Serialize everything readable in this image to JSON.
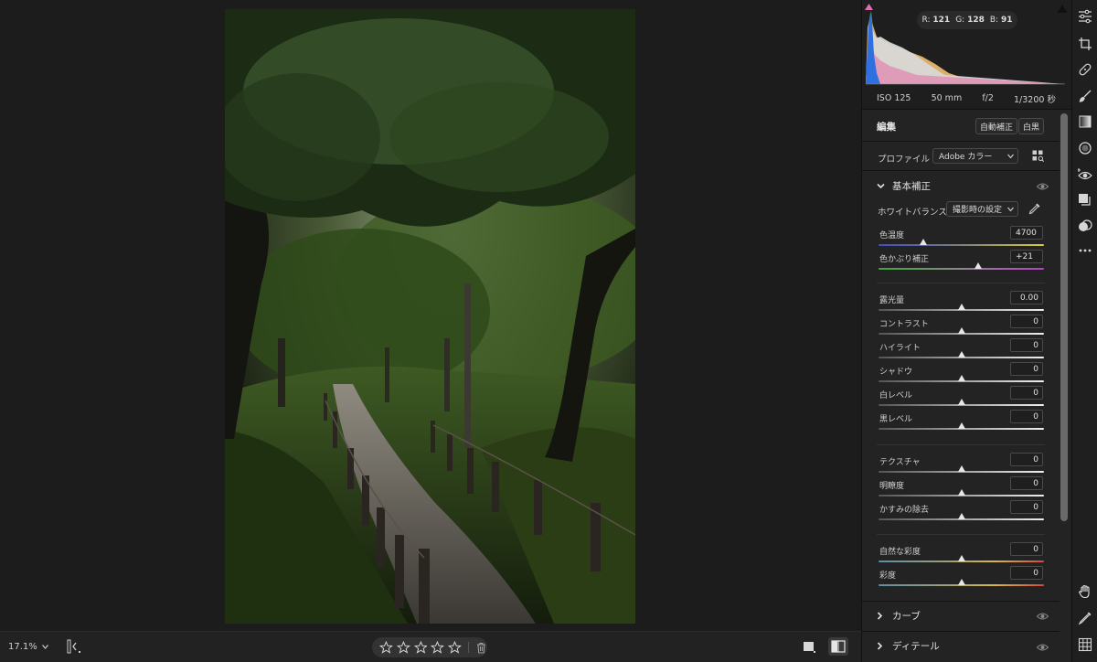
{
  "canvas": {
    "zoom_label": "17.1%"
  },
  "rating": {
    "stars": 0,
    "max": 5
  },
  "histogram": {
    "r_label": "R:",
    "r_value": "121",
    "g_label": "G:",
    "g_value": "128",
    "b_label": "B:",
    "b_value": "91"
  },
  "exif": {
    "iso": "ISO 125",
    "focal": "50 mm",
    "aperture": "f/2",
    "shutter": "1/3200 秒"
  },
  "edit": {
    "title": "編集",
    "auto_label": "自動補正",
    "bw_label": "白黒",
    "profile_label": "プロファイル",
    "profile_value": "Adobe カラー"
  },
  "basic": {
    "title": "基本補正",
    "wb_label": "ホワイトバランス",
    "wb_value": "撮影時の設定",
    "sliders": [
      {
        "label": "色温度",
        "value": "4700",
        "pos": 0.27,
        "track": "temp"
      },
      {
        "label": "色かぶり補正",
        "value": "+21",
        "pos": 0.6,
        "track": "tint"
      },
      {
        "label": "露光量",
        "value": "0.00",
        "pos": 0.5,
        "track": "plain"
      },
      {
        "label": "コントラスト",
        "value": "0",
        "pos": 0.5,
        "track": "plain"
      },
      {
        "label": "ハイライト",
        "value": "0",
        "pos": 0.5,
        "track": "plain"
      },
      {
        "label": "シャドウ",
        "value": "0",
        "pos": 0.5,
        "track": "plain"
      },
      {
        "label": "白レベル",
        "value": "0",
        "pos": 0.5,
        "track": "plain"
      },
      {
        "label": "黒レベル",
        "value": "0",
        "pos": 0.5,
        "track": "plain"
      },
      {
        "label": "テクスチャ",
        "value": "0",
        "pos": 0.5,
        "track": "plain"
      },
      {
        "label": "明瞭度",
        "value": "0",
        "pos": 0.5,
        "track": "plain"
      },
      {
        "label": "かすみの除去",
        "value": "0",
        "pos": 0.5,
        "track": "plain"
      },
      {
        "label": "自然な彩度",
        "value": "0",
        "pos": 0.5,
        "track": "sat"
      },
      {
        "label": "彩度",
        "value": "0",
        "pos": 0.5,
        "track": "sat"
      }
    ]
  },
  "sections": {
    "curve": "カーブ",
    "detail": "ディテール"
  },
  "icons": {
    "toolbar": [
      "edit-sliders-icon",
      "crop-icon",
      "healing-icon",
      "brush-icon",
      "linear-gradient-icon",
      "radial-gradient-icon",
      "red-eye-icon",
      "presets-icon",
      "snapshots-icon",
      "more-icon",
      "hand-icon",
      "zoom-icon",
      "grid-icon"
    ]
  },
  "colors": {
    "accent": "#e8e8e8",
    "panel": "#232323",
    "canvas": "#1c1c1c"
  }
}
